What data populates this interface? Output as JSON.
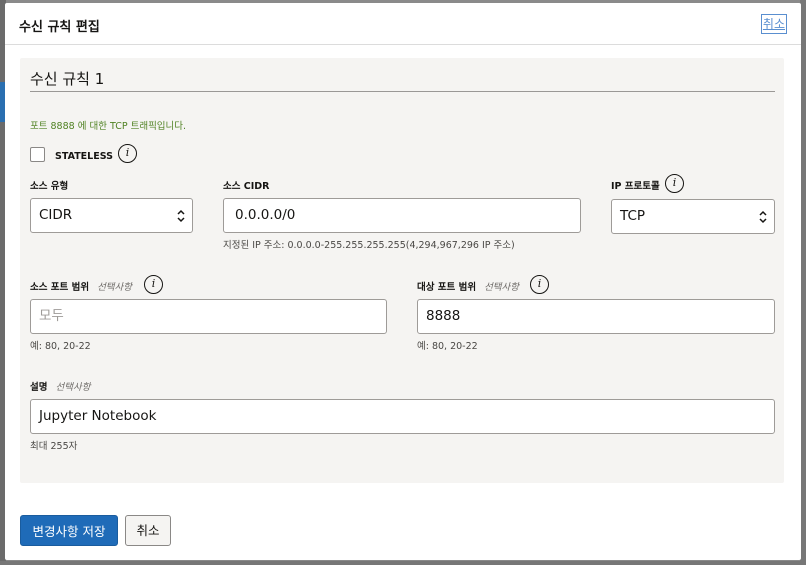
{
  "dialog": {
    "title": "수신 규칙 편집",
    "close_label": "취소"
  },
  "rule": {
    "section_title": "수신 규칙 1",
    "description_hint": "포트 8888 에 대한 TCP 트래픽입니다.",
    "stateless": {
      "label": "STATELESS",
      "checked": false
    },
    "source_type": {
      "label": "소스 유형",
      "value": "CIDR"
    },
    "source_cidr": {
      "label": "소스 CIDR",
      "value": "0.0.0.0/0",
      "help": "지정된 IP 주소: 0.0.0.0-255.255.255.255(4,294,967,296 IP 주소)"
    },
    "ip_protocol": {
      "label": "IP 프로토콜",
      "value": "TCP"
    },
    "source_port_range": {
      "label": "소스 포트 범위",
      "optional": "선택사항",
      "placeholder": "모두",
      "value": "",
      "help": "예: 80, 20-22"
    },
    "destination_port_range": {
      "label": "대상 포트 범위",
      "optional": "선택사항",
      "value": "8888",
      "help": "예: 80, 20-22"
    },
    "description": {
      "label": "설명",
      "optional": "선택사항",
      "value": "Jupyter Notebook",
      "help": "최대 255자"
    }
  },
  "footer": {
    "save_label": "변경사항 저장",
    "cancel_label": "취소"
  },
  "icons": {
    "info": "info-icon",
    "chevron": "up-down-chevron-icon"
  },
  "colors": {
    "primary": "#1f6bb8",
    "hint_green": "#508223",
    "link": "#5a8fd0"
  }
}
